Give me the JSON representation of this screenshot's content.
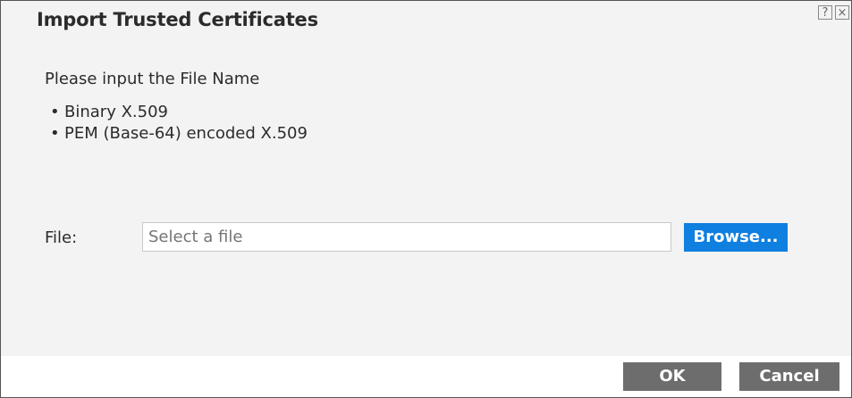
{
  "dialog": {
    "title": "Import Trusted Certificates",
    "help_glyph": "?",
    "close_glyph": "×"
  },
  "content": {
    "prompt": "Please input the File Name",
    "formats": [
      "Binary X.509",
      "PEM (Base-64) encoded X.509"
    ]
  },
  "file": {
    "label": "File:",
    "placeholder": "Select a file",
    "value": "",
    "browse_label": "Browse..."
  },
  "footer": {
    "ok_label": "OK",
    "cancel_label": "Cancel"
  },
  "colors": {
    "accent": "#0f7fe0",
    "button_gray": "#6d6d6d",
    "body_bg": "#f3f3f3"
  },
  "icons": [
    "help-icon",
    "close-icon"
  ]
}
